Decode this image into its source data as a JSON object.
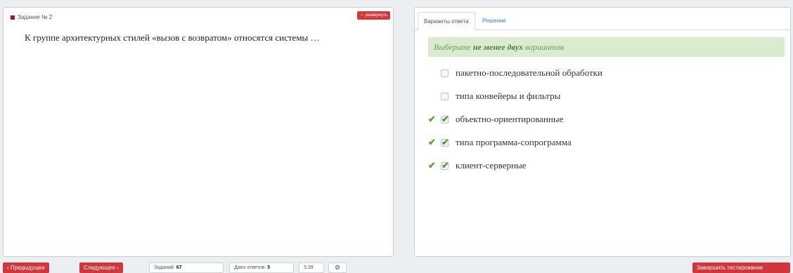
{
  "question_panel": {
    "task_label": "Задание № 2",
    "expand_label": "⇔ развернуть",
    "question_text": "К группе архитектурных стилей «вызов с возвратом» относятся системы …"
  },
  "answer_panel": {
    "tabs": [
      {
        "label": "Варианты ответа",
        "active": true
      },
      {
        "label": "Решение",
        "active": false
      }
    ],
    "hint_prefix": "Выберите ",
    "hint_bold": "не менее двух",
    "hint_suffix": " вариантов",
    "options": [
      {
        "label": "пакетно-последовательной обработки",
        "checked": false,
        "correct": false
      },
      {
        "label": "типа конвейеры и фильтры",
        "checked": false,
        "correct": false
      },
      {
        "label": "объектно-ориентированные",
        "checked": true,
        "correct": true
      },
      {
        "label": "типа программа-сопрограмма",
        "checked": true,
        "correct": true
      },
      {
        "label": "клиент-серверные",
        "checked": true,
        "correct": true
      }
    ]
  },
  "footer": {
    "prev_label": "‹ Предыдущее",
    "next_label": "Следующее ›",
    "tasks_label": "Заданий: ",
    "tasks_count": "67",
    "answers_label": "Дано ответов: ",
    "answers_count": "5",
    "timer": "5:39",
    "finish_label": "Завершить тестирование"
  },
  "colors": {
    "accent_red": "#d0363a",
    "hint_green": "#d9ecd0",
    "check_green": "#4da12f"
  }
}
